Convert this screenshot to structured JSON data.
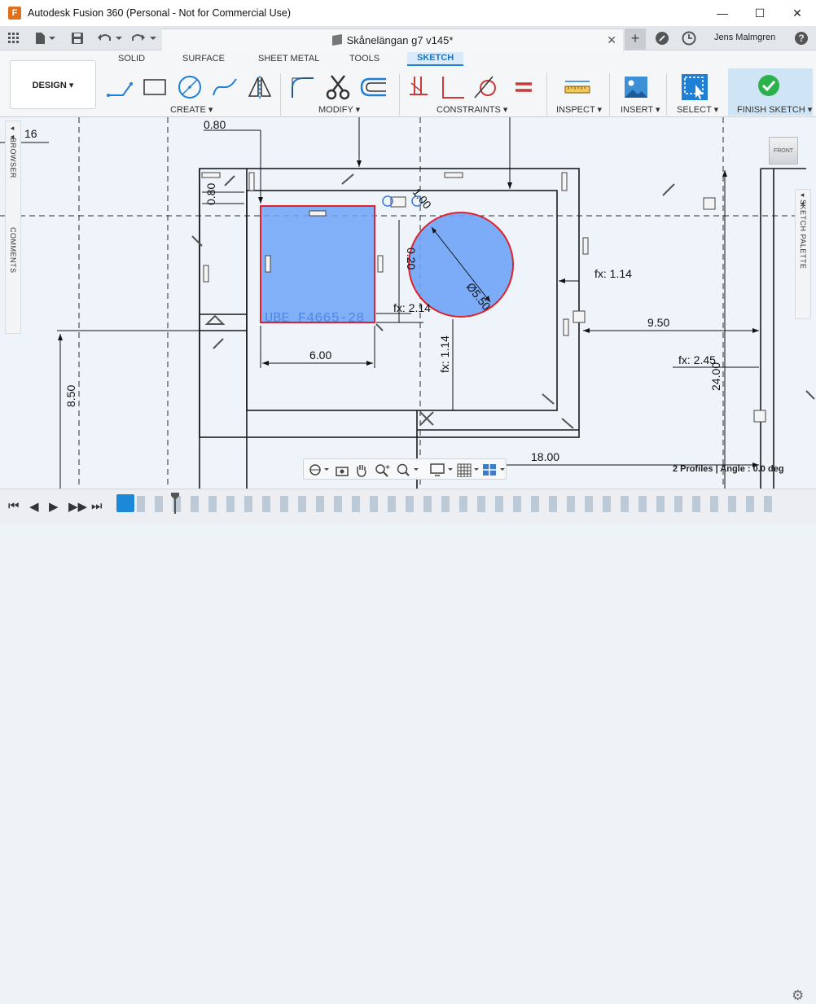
{
  "window": {
    "title": "Autodesk Fusion 360 (Personal - Not for Commercial Use)",
    "controls": [
      "—",
      "☐",
      "✕"
    ]
  },
  "qat": {
    "doc_tab_title": "Skånelängan g7 v145*",
    "user": "Jens Malmgren",
    "help": "?"
  },
  "ribbon": {
    "tabs": [
      "SOLID",
      "SURFACE",
      "SHEET METAL",
      "TOOLS",
      "SKETCH"
    ],
    "active_tab": "SKETCH",
    "workspace": "DESIGN ▾",
    "groups": {
      "create": "CREATE ▾",
      "modify": "MODIFY ▾",
      "constraints": "CONSTRAINTS ▾",
      "inspect": "INSPECT ▾",
      "insert": "INSERT ▾",
      "select": "SELECT ▾",
      "finish": "FINISH SKETCH ▾"
    }
  },
  "panels": {
    "browser": "BROWSER",
    "comments": "COMMENTS",
    "sketch_palette": "SKETCH PALETTE",
    "viewcube_face": "FRONT"
  },
  "dimensions": {
    "d16": "16",
    "d080_top": "0.80",
    "d080_left": "0.80",
    "d600": "6.00",
    "d550": "Ø5.50",
    "d100": "1.00",
    "d020": "0.20",
    "fx_214": "fx: 2.14",
    "fx_114_v": "fx: 1.14",
    "fx_114_h": "fx: 1.14",
    "d950": "9.50",
    "fx_245": "fx: 2.45",
    "d2400": "24.00",
    "d850": "8.50",
    "d1800": "18.00",
    "ghost_text": "UBE F4665-28"
  },
  "status": {
    "profiles": "2 Profiles | Angle : 0.0 deg"
  },
  "colors": {
    "accent": "#1e7fd4",
    "profile_fill": "#6fa3f7",
    "selection_red": "#e0202a",
    "canvas_bg": "#eef4fa"
  }
}
